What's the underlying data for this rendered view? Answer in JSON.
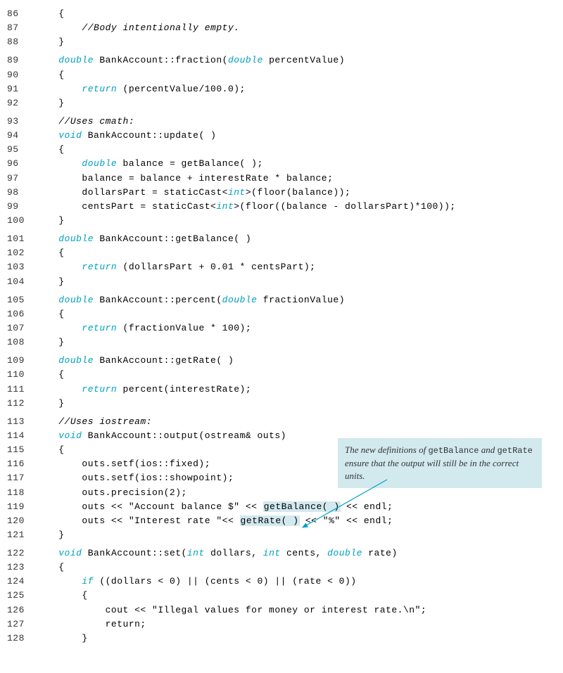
{
  "annotation": {
    "part1": "The new definitions of ",
    "mono1": "getBalance",
    "part2": " and ",
    "mono2": "getRate",
    "part3": " ensure that the output will still be in the correct units."
  },
  "groups": [
    {
      "lines": [
        {
          "n": "86",
          "tokens": [
            [
              "    {",
              "plain"
            ]
          ]
        },
        {
          "n": "87",
          "tokens": [
            [
              "        ",
              "plain"
            ],
            [
              "//Body intentionally empty.",
              "cmt"
            ]
          ]
        },
        {
          "n": "88",
          "tokens": [
            [
              "    }",
              "plain"
            ]
          ]
        }
      ]
    },
    {
      "lines": [
        {
          "n": "89",
          "tokens": [
            [
              "    ",
              "plain"
            ],
            [
              "double",
              "kw"
            ],
            [
              " BankAccount::fraction(",
              "plain"
            ],
            [
              "double",
              "kw"
            ],
            [
              " percentValue)",
              "plain"
            ]
          ]
        },
        {
          "n": "90",
          "tokens": [
            [
              "    {",
              "plain"
            ]
          ]
        },
        {
          "n": "91",
          "tokens": [
            [
              "        ",
              "plain"
            ],
            [
              "return",
              "kw"
            ],
            [
              " (percentValue/100.0);",
              "plain"
            ]
          ]
        },
        {
          "n": "92",
          "tokens": [
            [
              "    }",
              "plain"
            ]
          ]
        }
      ]
    },
    {
      "lines": [
        {
          "n": "93",
          "tokens": [
            [
              "    ",
              "plain"
            ],
            [
              "//Uses cmath:",
              "cmt"
            ]
          ]
        },
        {
          "n": "94",
          "tokens": [
            [
              "    ",
              "plain"
            ],
            [
              "void",
              "kw"
            ],
            [
              " BankAccount::update( )",
              "plain"
            ]
          ]
        },
        {
          "n": "95",
          "tokens": [
            [
              "    {",
              "plain"
            ]
          ]
        },
        {
          "n": "96",
          "tokens": [
            [
              "        ",
              "plain"
            ],
            [
              "double",
              "kw"
            ],
            [
              " balance = getBalance( );",
              "plain"
            ]
          ]
        },
        {
          "n": "97",
          "tokens": [
            [
              "        balance = balance + interestRate * balance;",
              "plain"
            ]
          ]
        },
        {
          "n": "98",
          "tokens": [
            [
              "        dollarsPart = staticCast<",
              "plain"
            ],
            [
              "int",
              "kw"
            ],
            [
              ">(floor(balance));",
              "plain"
            ]
          ]
        },
        {
          "n": "99",
          "tokens": [
            [
              "        centsPart = staticCast<",
              "plain"
            ],
            [
              "int",
              "kw"
            ],
            [
              ">(floor((balance - dollarsPart)*100));",
              "plain"
            ]
          ]
        },
        {
          "n": "100",
          "tokens": [
            [
              "    }",
              "plain"
            ]
          ]
        }
      ]
    },
    {
      "lines": [
        {
          "n": "101",
          "tokens": [
            [
              "    ",
              "plain"
            ],
            [
              "double",
              "kw"
            ],
            [
              " BankAccount::getBalance( )",
              "plain"
            ]
          ]
        },
        {
          "n": "102",
          "tokens": [
            [
              "    {",
              "plain"
            ]
          ]
        },
        {
          "n": "103",
          "tokens": [
            [
              "        ",
              "plain"
            ],
            [
              "return",
              "kw"
            ],
            [
              " (dollarsPart + 0.01 * centsPart);",
              "plain"
            ]
          ]
        },
        {
          "n": "104",
          "tokens": [
            [
              "    }",
              "plain"
            ]
          ]
        }
      ]
    },
    {
      "lines": [
        {
          "n": "105",
          "tokens": [
            [
              "    ",
              "plain"
            ],
            [
              "double",
              "kw"
            ],
            [
              " BankAccount::percent(",
              "plain"
            ],
            [
              "double",
              "kw"
            ],
            [
              " fractionValue)",
              "plain"
            ]
          ]
        },
        {
          "n": "106",
          "tokens": [
            [
              "    {",
              "plain"
            ]
          ]
        },
        {
          "n": "107",
          "tokens": [
            [
              "        ",
              "plain"
            ],
            [
              "return",
              "kw"
            ],
            [
              " (fractionValue * 100);",
              "plain"
            ]
          ]
        },
        {
          "n": "108",
          "tokens": [
            [
              "    }",
              "plain"
            ]
          ]
        }
      ]
    },
    {
      "lines": [
        {
          "n": "109",
          "tokens": [
            [
              "    ",
              "plain"
            ],
            [
              "double",
              "kw"
            ],
            [
              " BankAccount::getRate( )",
              "plain"
            ]
          ]
        },
        {
          "n": "110",
          "tokens": [
            [
              "    {",
              "plain"
            ]
          ]
        },
        {
          "n": "111",
          "tokens": [
            [
              "        ",
              "plain"
            ],
            [
              "return",
              "kw"
            ],
            [
              " percent(interestRate);",
              "plain"
            ]
          ]
        },
        {
          "n": "112",
          "tokens": [
            [
              "    }",
              "plain"
            ]
          ]
        }
      ]
    },
    {
      "lines": [
        {
          "n": "113",
          "tokens": [
            [
              "    ",
              "plain"
            ],
            [
              "//Uses iostream:",
              "cmt"
            ]
          ]
        },
        {
          "n": "114",
          "tokens": [
            [
              "    ",
              "plain"
            ],
            [
              "void",
              "kw"
            ],
            [
              " BankAccount::output(ostream& outs)",
              "plain"
            ]
          ]
        },
        {
          "n": "115",
          "tokens": [
            [
              "    {",
              "plain"
            ]
          ]
        },
        {
          "n": "116",
          "tokens": [
            [
              "        outs.setf(ios::fixed);",
              "plain"
            ]
          ]
        },
        {
          "n": "117",
          "tokens": [
            [
              "        outs.setf(ios::showpoint);",
              "plain"
            ]
          ]
        },
        {
          "n": "118",
          "tokens": [
            [
              "        outs.precision(2);",
              "plain"
            ]
          ]
        },
        {
          "n": "119",
          "tokens": [
            [
              "        outs << \"Account balance $\" << ",
              "plain"
            ],
            [
              "getBalance( )",
              "hl"
            ],
            [
              " << endl;",
              "plain"
            ]
          ]
        },
        {
          "n": "120",
          "tokens": [
            [
              "        outs << \"Interest rate \"<< ",
              "plain"
            ],
            [
              "getRate( )",
              "hl"
            ],
            [
              " << \"%\" << endl;",
              "plain"
            ]
          ]
        },
        {
          "n": "121",
          "tokens": [
            [
              "    }",
              "plain"
            ]
          ]
        }
      ]
    },
    {
      "lines": [
        {
          "n": "122",
          "tokens": [
            [
              "    ",
              "plain"
            ],
            [
              "void",
              "kw"
            ],
            [
              " BankAccount::set(",
              "plain"
            ],
            [
              "int",
              "kw"
            ],
            [
              " dollars, ",
              "plain"
            ],
            [
              "int",
              "kw"
            ],
            [
              " cents, ",
              "plain"
            ],
            [
              "double",
              "kw"
            ],
            [
              " rate)",
              "plain"
            ]
          ]
        },
        {
          "n": "123",
          "tokens": [
            [
              "    {",
              "plain"
            ]
          ]
        },
        {
          "n": "124",
          "tokens": [
            [
              "        ",
              "plain"
            ],
            [
              "if",
              "kw"
            ],
            [
              " ((dollars < 0) || (cents < 0) || (rate < 0))",
              "plain"
            ]
          ]
        },
        {
          "n": "125",
          "tokens": [
            [
              "        {",
              "plain"
            ]
          ]
        },
        {
          "n": "126",
          "tokens": [
            [
              "            cout << \"Illegal values for money or interest rate.\\n\";",
              "plain"
            ]
          ]
        },
        {
          "n": "127",
          "tokens": [
            [
              "            return;",
              "plain"
            ]
          ]
        },
        {
          "n": "128",
          "tokens": [
            [
              "        }",
              "plain"
            ]
          ]
        }
      ]
    }
  ]
}
